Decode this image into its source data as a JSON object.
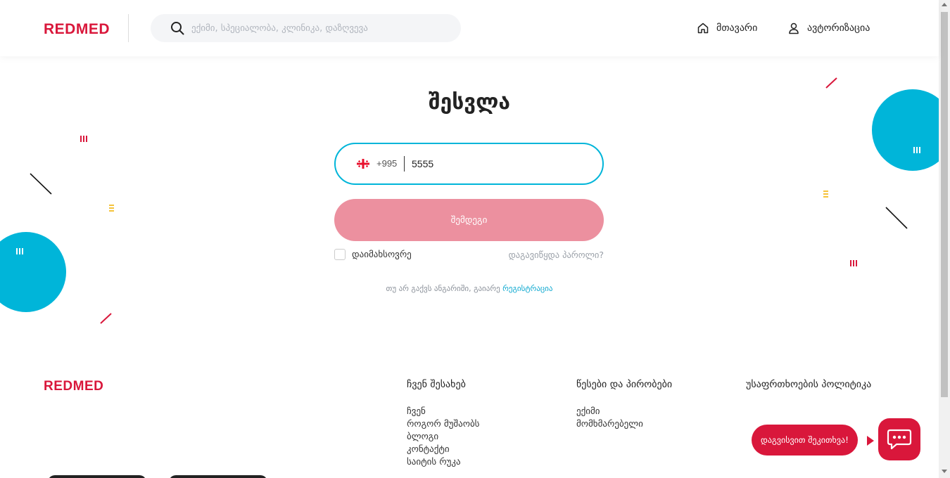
{
  "header": {
    "logo": "REDMED",
    "search": {
      "placeholder": "ექიმი, სპეციალობა, კლინიკა, დაზღვევა",
      "value": ""
    },
    "nav": [
      {
        "label": "მთავარი",
        "icon": "home-icon"
      },
      {
        "label": "ავტორიზაცია",
        "icon": "user-icon"
      }
    ]
  },
  "login": {
    "title": "შესვლა",
    "country_code": "+995",
    "flag": "georgia-flag",
    "phone_value": "5555",
    "next_label": "შემდეგი",
    "remember_label": "დაიმახსოვრე",
    "remember_checked": false,
    "forgot_label": "დაგავიწყდა პაროლი?",
    "register_text": "თუ არ გაქვს ანგარიში, გაიარე ",
    "register_link": "რეგისტრაცია"
  },
  "footer": {
    "logo": "REDMED",
    "columns": [
      {
        "title": "ჩვენ შესახებ",
        "links": [
          "ჩვენ",
          "როგორ მუშაობს",
          "ბლოგი",
          "კონტაქტი",
          "საიტის რუკა"
        ]
      },
      {
        "title": "წესები და პირობები",
        "links": [
          "ექიმი",
          "მომხმარებელი"
        ]
      },
      {
        "title": "უსაფრთხოების პოლიტიკა",
        "links": []
      }
    ]
  },
  "chat": {
    "label": "დაგვისვით შეკითხვა!",
    "icon": "chat-icon"
  },
  "colors": {
    "brand_red": "#d9173b",
    "accent_cyan": "#00b5d9",
    "button_disabled": "#ec909f",
    "link": "#0aa7cf",
    "yellow": "#f5c33b"
  }
}
